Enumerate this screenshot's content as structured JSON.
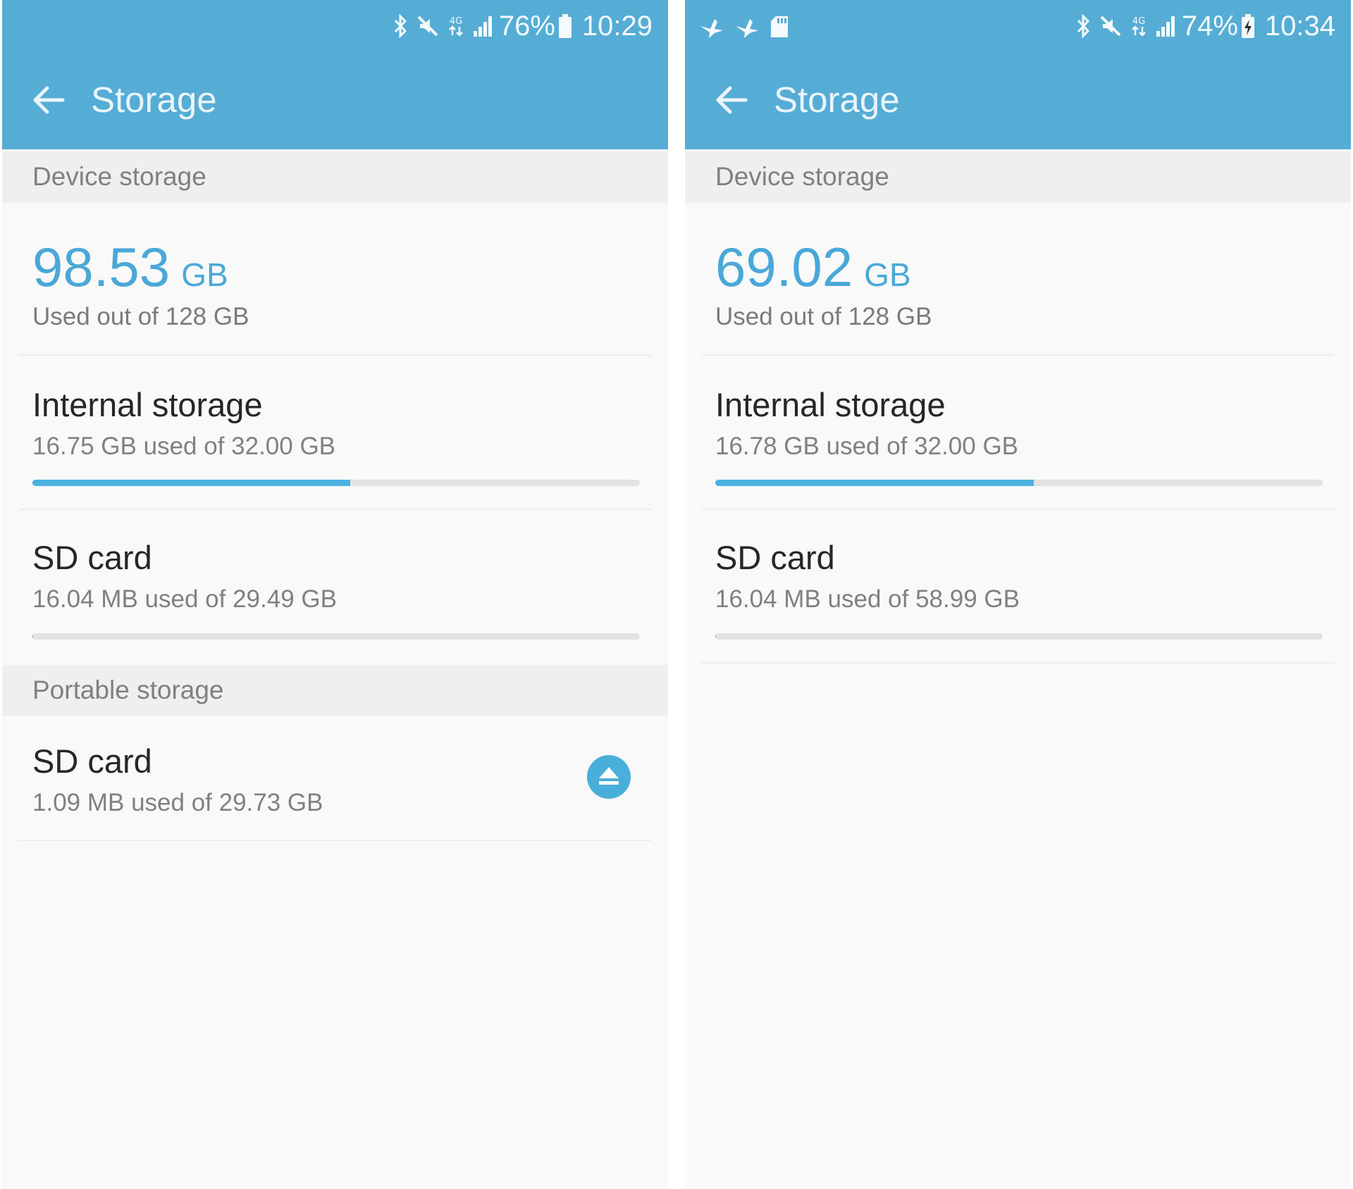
{
  "colors": {
    "app_bar": "#55add6",
    "accent": "#4aa8d8",
    "progress_fill": "#4bb1de",
    "progress_track": "#e2e2e2",
    "section_header_bg": "#efefef",
    "screen_bg": "#f9f9f9"
  },
  "left": {
    "status_bar": {
      "icons": [
        "bluetooth-icon",
        "mute-icon",
        "4g-icon",
        "signal-icon",
        "battery-icon"
      ],
      "battery": "76%",
      "time": "10:29"
    },
    "app_bar": {
      "back_icon": "arrow-left-icon",
      "title": "Storage"
    },
    "device_storage": {
      "header": "Device storage",
      "used_value": "98.53",
      "used_unit": "GB",
      "total_label": "Used out of 128 GB"
    },
    "internal_storage": {
      "title": "Internal storage",
      "usage": "16.75 GB used of 32.00 GB",
      "fraction": 0.5234
    },
    "sd_card": {
      "title": "SD card",
      "usage": "16.04 MB used of 29.49 GB",
      "fraction": 0.0005
    },
    "portable_storage": {
      "header": "Portable storage",
      "sd_card": {
        "title": "SD card",
        "usage": "1.09 MB used of 29.73 GB",
        "action_icon": "eject-icon"
      }
    }
  },
  "right": {
    "status_bar": {
      "notification_icons": [
        "bird-icon",
        "bird-icon",
        "sd-card-icon"
      ],
      "icons": [
        "bluetooth-icon",
        "mute-icon",
        "4g-icon",
        "signal-icon",
        "battery-charging-icon"
      ],
      "battery": "74%",
      "time": "10:34"
    },
    "app_bar": {
      "back_icon": "arrow-left-icon",
      "title": "Storage"
    },
    "device_storage": {
      "header": "Device storage",
      "used_value": "69.02",
      "used_unit": "GB",
      "total_label": "Used out of 128 GB"
    },
    "internal_storage": {
      "title": "Internal storage",
      "usage": "16.78 GB used of 32.00 GB",
      "fraction": 0.5244
    },
    "sd_card": {
      "title": "SD card",
      "usage": "16.04 MB used of 58.99 GB",
      "fraction": 0.0003
    }
  }
}
